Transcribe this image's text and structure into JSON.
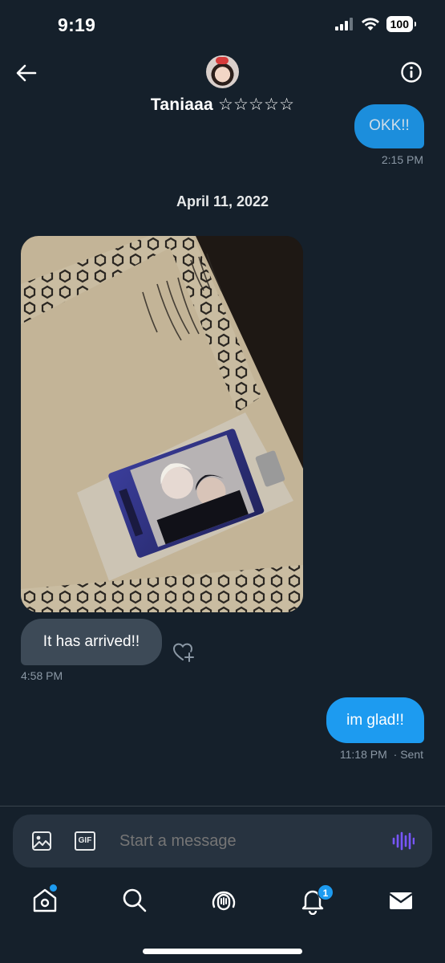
{
  "status_bar": {
    "time": "9:19",
    "battery": "100",
    "icons": [
      "signal-icon",
      "wifi-icon",
      "battery-icon"
    ]
  },
  "header": {
    "contact_name": "Taniaaa ☆☆☆☆☆",
    "back_icon": "back-arrow-icon",
    "info_icon": "info-icon"
  },
  "messages": [
    {
      "direction": "outgoing",
      "text": "OKK!!",
      "time": "2:15 PM"
    },
    {
      "type": "date_separator",
      "text": "April 11, 2022"
    },
    {
      "direction": "incoming",
      "type": "image",
      "alt_icon": "photo-card-image"
    },
    {
      "direction": "incoming",
      "text": "It has arrived!!",
      "time": "4:58 PM",
      "reaction_icon": "add-reaction-heart-icon"
    },
    {
      "direction": "outgoing",
      "text": "im glad!!",
      "time": "11:18 PM",
      "status": "· Sent"
    }
  ],
  "composer": {
    "placeholder": "Start a message",
    "gif_label": "GIF",
    "icons": [
      "image-icon",
      "gif-icon",
      "voice-message-icon"
    ]
  },
  "bottom_nav": {
    "items": [
      {
        "name": "home",
        "icon": "home-icon",
        "badge_dot": true
      },
      {
        "name": "search",
        "icon": "search-icon"
      },
      {
        "name": "spaces",
        "icon": "spaces-icon"
      },
      {
        "name": "notifications",
        "icon": "bell-icon",
        "badge_count": "1"
      },
      {
        "name": "messages",
        "icon": "mail-icon",
        "active": true
      }
    ]
  },
  "colors": {
    "background": "#15202b",
    "accent": "#1d9bf0",
    "incoming_bubble": "#3d4a57",
    "meta_text": "#8b98a5"
  }
}
